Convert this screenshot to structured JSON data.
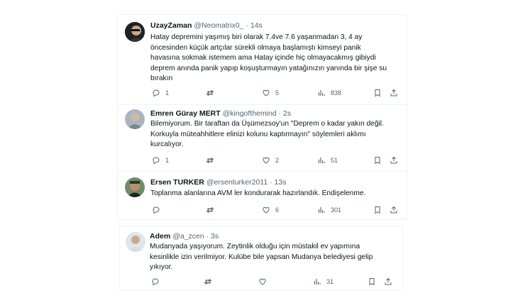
{
  "tweets": [
    {
      "name": "UzayZaman",
      "handle": "@Neomatrix0_ · 14s",
      "text": "Hatay depremini yaşımış biri olarak 7.4ve 7.6 yaşanmadan 3, 4 ay\nöncesinden küçük artçılar sürekli olmaya başlamıştı kimseyi panik\nhavasına sokmak istemem ama Hatay içinde hiç olmayacakmış gibiydi\ndeprem anında panik yapıp koşuşturmayın yatağınızın yanında bir şişe su\nbırakın",
      "replies": "1",
      "retweets": "",
      "likes": "5",
      "views": "838"
    },
    {
      "name": "Emren Güray MERT",
      "handle": "@kingofthemind · 2s",
      "text": "Bilemiyorum. Bir taraftan da Üşümezsoy'un \"Deprem o kadar yakın değil.\nKorkuyla müteahhitlere elinizi kolunu kaptırmayın\" söylemleri aklımı\nkurcalıyor.",
      "replies": "1",
      "retweets": "",
      "likes": "2",
      "views": "51"
    },
    {
      "name": "Ersen TURKER",
      "handle": "@ersenturker2011 · 13s",
      "text": "Toplanma alanlarına AVM ler kondurarak hazırlandık. Endişelenme.",
      "replies": "",
      "retweets": "",
      "likes": "6",
      "views": "301"
    },
    {
      "name": "Adem",
      "handle": "@a_zcen · 3s",
      "text": "Mudanyada yaşıyorum. Zeytinlik olduğu için müstakil ev yapımına\nkesinlikle izin verilmiyor. Kulübe bile yapsan Mudanya belediyesi gelip\nyıkıyor.",
      "replies": "",
      "retweets": "",
      "likes": "",
      "views": "31"
    }
  ],
  "icons": {
    "reply": "reply-icon",
    "retweet": "retweet-icon",
    "like": "like-icon",
    "views": "views-icon",
    "bookmark": "bookmark-icon",
    "share": "share-icon"
  },
  "colors": {
    "text": "#0f1419",
    "secondary": "#536471",
    "border": "#eff3f4"
  }
}
